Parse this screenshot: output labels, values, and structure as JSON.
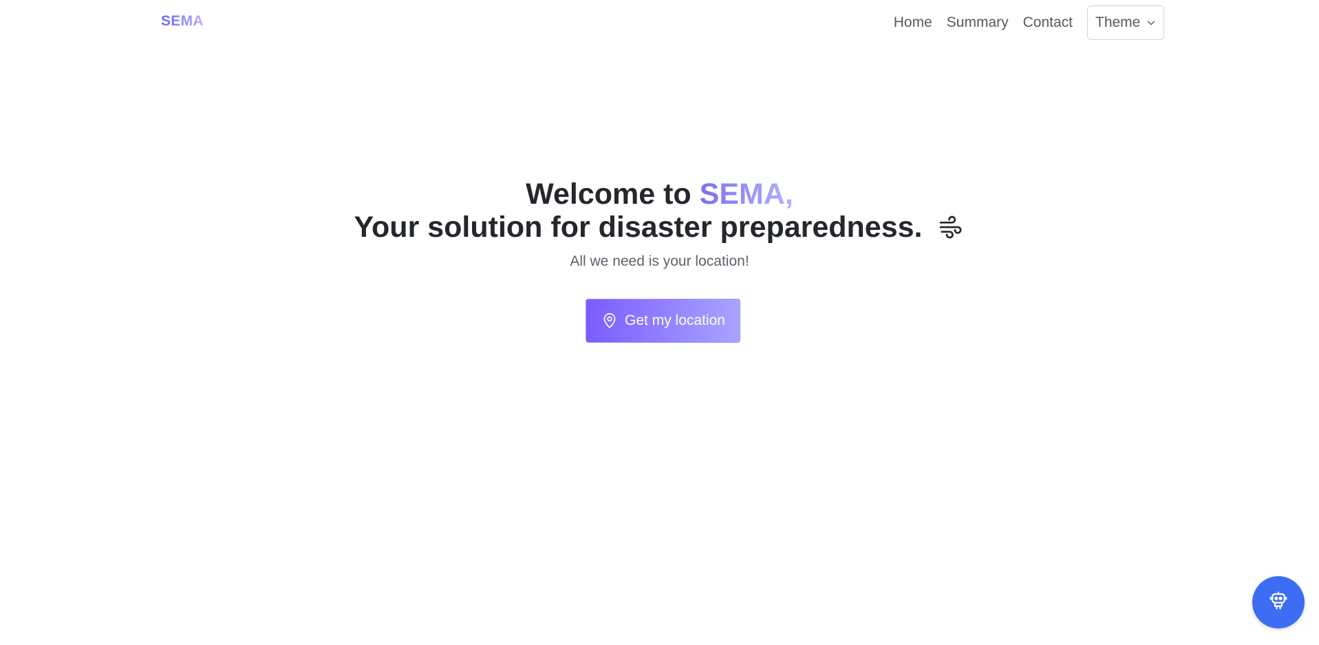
{
  "navbar": {
    "brand": "SEMA",
    "links": [
      {
        "label": "Home"
      },
      {
        "label": "Summary"
      },
      {
        "label": "Contact"
      }
    ],
    "theme": {
      "label": "Theme",
      "icon": "chevron-down-icon"
    }
  },
  "hero": {
    "title_prefix": "Welcome to ",
    "title_accent": "SEMA,",
    "title_line2": "Your solution for disaster preparedness.",
    "title_icon": "wind-icon",
    "subtitle": "All we need is your location!"
  },
  "cta": {
    "label": "Get my location",
    "icon": "map-pin-icon"
  },
  "chat": {
    "icon": "robot-icon"
  },
  "colors": {
    "accent_start": "#7a6ff5",
    "accent_end": "#b5b2ff",
    "fab": "#3d6df2",
    "text_dark": "#24272b",
    "text_muted": "#5c636a"
  }
}
